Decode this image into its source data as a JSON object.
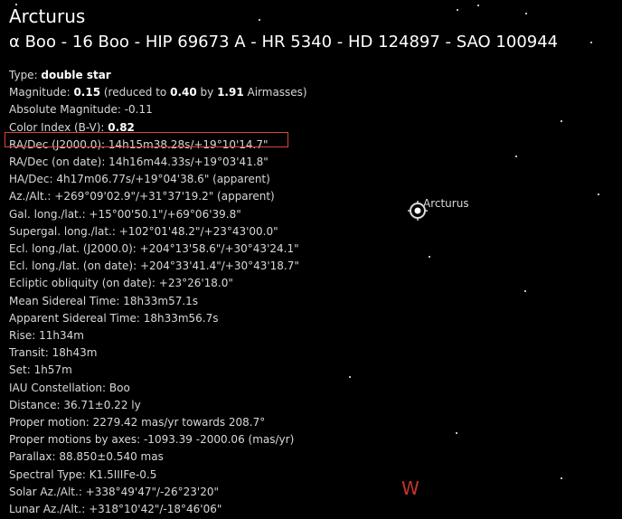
{
  "object": {
    "name": "Arcturus",
    "identifiers": "α Boo - 16 Boo - HIP 69673 A - HR 5340 - HD 124897 - SAO 100944"
  },
  "info": [
    {
      "label": "Type: ",
      "value": "double star"
    },
    {
      "label": "Magnitude: ",
      "value": "0.15",
      "mid": " (reduced to ",
      "value2": "0.40",
      "mid2": " by ",
      "value3": "1.91",
      "tail": " Airmasses)"
    },
    {
      "label": "Absolute Magnitude: -0.11"
    },
    {
      "label": "Color Index (B-V): ",
      "value": "0.82"
    },
    {
      "label": "RA/Dec (J2000.0): 14h15m38.28s/+19°10'14.7\""
    },
    {
      "label": "RA/Dec (on date): 14h16m44.33s/+19°03'41.8\""
    },
    {
      "label": "HA/Dec: 4h17m06.77s/+19°04'38.6\" (apparent)"
    },
    {
      "label": "Az./Alt.: +269°09'02.9\"/+31°37'19.2\" (apparent)"
    },
    {
      "label": "Gal. long./lat.: +15°00'50.1\"/+69°06'39.8\""
    },
    {
      "label": "Supergal. long./lat.: +102°01'48.2\"/+23°43'00.0\""
    },
    {
      "label": "Ecl. long./lat. (J2000.0): +204°13'58.6\"/+30°43'24.1\""
    },
    {
      "label": "Ecl. long./lat. (on date): +204°33'41.4\"/+30°43'18.7\""
    },
    {
      "label": "Ecliptic obliquity (on date): +23°26'18.0\""
    },
    {
      "label": "Mean Sidereal Time: 18h33m57.1s"
    },
    {
      "label": "Apparent Sidereal Time: 18h33m56.7s"
    },
    {
      "label": "Rise: 11h34m"
    },
    {
      "label": "Transit: 18h43m"
    },
    {
      "label": "Set: 1h57m"
    },
    {
      "label": "IAU Constellation: Boo"
    },
    {
      "label": "Distance: 36.71±0.22 ly"
    },
    {
      "label": "Proper motion: 2279.42 mas/yr towards 208.7°"
    },
    {
      "label": "Proper motions by axes: -1093.39 -2000.06 (mas/yr)"
    },
    {
      "label": "Parallax: 88.850±0.540 mas"
    },
    {
      "label": "Spectral Type: K1.5IIIFe-0.5"
    },
    {
      "label": "Solar Az./Alt.: +338°49'47\"/-26°23'20\""
    },
    {
      "label": "Lunar Az./Alt.: +318°10'42\"/-18°46'06\""
    }
  ],
  "sky_label": "Arcturus",
  "cardinal": "W",
  "colors": {
    "background": "#000000",
    "text": "#d8d8d8",
    "highlight": "#d9453b",
    "cardinal": "#c4342c"
  }
}
